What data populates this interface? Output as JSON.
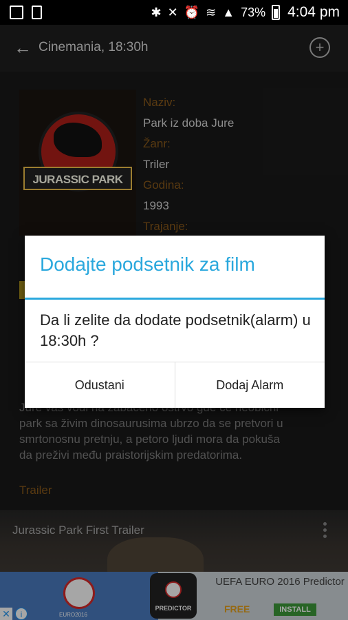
{
  "statusbar": {
    "battery": "73%",
    "time": "4:04 pm"
  },
  "appbar": {
    "back_icon": "←",
    "title": "Cinemania, 18:30h"
  },
  "movie": {
    "poster_text": "JURASSIC PARK",
    "labels": {
      "name": "Naziv:",
      "genre": "Žanr:",
      "year": "Godina:",
      "duration": "Trajanje:"
    },
    "values": {
      "name": "Park iz doba Jure",
      "genre": "Triler",
      "year": "1993"
    },
    "plot_lines": [
      "Jure vas vodi na zabačeno ostrvo gde će neobični",
      "park sa živim dinosaurusima ubrzo da se pretvori u",
      "smrtonosnu pretnju, a petoro ljudi mora da pokuša",
      "da preživi među praistorijskim predatorima."
    ],
    "trailer_label": "Trailer"
  },
  "video": {
    "title": "Jurassic Park First Trailer"
  },
  "ad": {
    "title": "UEFA EURO 2016 Predictor",
    "free": "FREE",
    "install": "INSTALL",
    "logo_label": "PREDICTOR",
    "badge_text": "EURO2016"
  },
  "dialog": {
    "title": "Dodajte podsetnik za film",
    "message": "Da li zelite da dodate podsetnik(alarm) u 18:30h ?",
    "cancel": "Odustani",
    "confirm": "Dodaj Alarm"
  },
  "colors": {
    "accent": "#2aa8dd",
    "label": "#8a5a1b"
  }
}
